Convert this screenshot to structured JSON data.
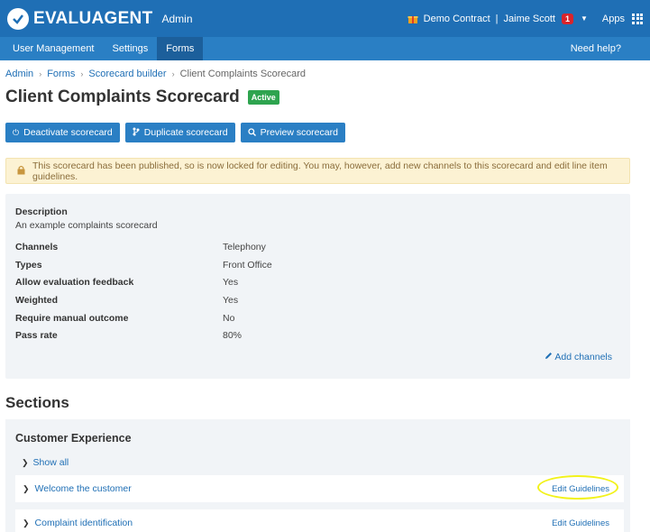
{
  "header": {
    "logo_text": "EVALUAGENT",
    "admin_label": "Admin",
    "contract": "Demo Contract",
    "separator": "|",
    "user": "Jaime Scott",
    "notification_count": "1",
    "apps_label": "Apps"
  },
  "nav": {
    "items": [
      "User Management",
      "Settings",
      "Forms"
    ],
    "active": "Forms",
    "help": "Need help?"
  },
  "breadcrumb": [
    "Admin",
    "Forms",
    "Scorecard builder",
    "Client Complaints Scorecard"
  ],
  "page": {
    "title": "Client Complaints Scorecard",
    "status": "Active"
  },
  "actions": {
    "deactivate": "Deactivate scorecard",
    "duplicate": "Duplicate scorecard",
    "preview": "Preview scorecard"
  },
  "alert": {
    "text": "This scorecard has been published, so is now locked for editing. You may, however, add new channels to this scorecard and edit line item guidelines."
  },
  "details": {
    "description_label": "Description",
    "description_value": "An example complaints scorecard",
    "rows": [
      {
        "key": "Channels",
        "value": "Telephony"
      },
      {
        "key": "Types",
        "value": "Front Office"
      },
      {
        "key": "Allow evaluation feedback",
        "value": "Yes"
      },
      {
        "key": "Weighted",
        "value": "Yes"
      },
      {
        "key": "Require manual outcome",
        "value": "No"
      },
      {
        "key": "Pass rate",
        "value": "80%"
      }
    ],
    "add_channels": "Add channels"
  },
  "sections": {
    "heading": "Sections",
    "card_title": "Customer Experience",
    "show_all": "Show all",
    "items": [
      {
        "label": "Welcome the customer",
        "edit": "Edit Guidelines"
      },
      {
        "label": "Complaint identification",
        "edit": "Edit Guidelines"
      }
    ]
  },
  "colors": {
    "brand": "#1f6fb5",
    "nav": "#2a7fc4",
    "active_badge": "#2ea44f",
    "alert_bg": "#fcf2d3",
    "highlight": "#f2f21a"
  }
}
